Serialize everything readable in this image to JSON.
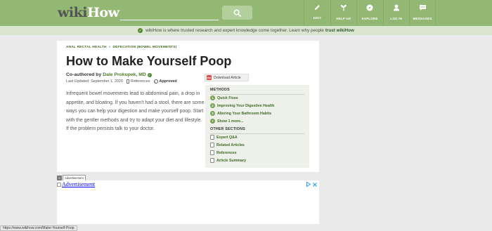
{
  "header": {
    "logo_prefix": "wiki",
    "logo_suffix": "How",
    "search_placeholder": "",
    "nav": [
      {
        "label": "EDIT",
        "icon": "pencil-icon"
      },
      {
        "label": "HELP US",
        "icon": "sprout-icon"
      },
      {
        "label": "EXPLORE",
        "icon": "compass-icon"
      },
      {
        "label": "LOG IN",
        "icon": "user-icon"
      },
      {
        "label": "MESSAGES",
        "icon": "chat-icon"
      }
    ]
  },
  "trust_bar": {
    "text": "wikiHow is where trusted research and expert knowledge come together. Learn why people",
    "bold": "trust wikiHow"
  },
  "article": {
    "breadcrumbs": [
      "ANAL RECTAL HEALTH",
      "DEFECATION (BOWEL MOVEMENTS)"
    ],
    "breadcrumb_separator": "»",
    "title": "How to Make Yourself Poop",
    "coauthor_prefix": "Co-authored by",
    "coauthor_name": "Dale Prokupek, MD",
    "last_updated": "Last Updated: September 1, 2020",
    "references_label": "References",
    "approved_label": "Approved",
    "intro": "Infrequent bowel movements lead to abdominal pain, a drop in appetite, and bloating. If you haven't had a stool, there are some ways you can help your digestion and make yourself poop. Start with the gentler methods and try to adapt your diet and lifestyle. If the problem persists talk to your doctor.",
    "download_label": "Download Article",
    "download_icon_text": "PDF"
  },
  "toc": {
    "methods_heading": "METHODS",
    "methods": [
      {
        "num": "1",
        "label": "Quick Fixes"
      },
      {
        "num": "2",
        "label": "Improving Your Digestive Health"
      },
      {
        "num": "3",
        "label": "Altering Your Bathroom Habits"
      },
      {
        "num": "+",
        "label": "Show 1 more..."
      }
    ],
    "other_heading": "OTHER SECTIONS",
    "other": [
      {
        "label": "Expert Q&A",
        "icon": "qa-icon"
      },
      {
        "label": "Related Articles",
        "icon": "related-articles-icon"
      },
      {
        "label": "References",
        "icon": "references-icon"
      },
      {
        "label": "Article Summary",
        "icon": "summary-icon"
      }
    ]
  },
  "ad": {
    "badge": "X",
    "label": "Advertisement",
    "image_alt": "Advertisement"
  },
  "status_bar": {
    "url": "https://www.wikihow.com/Make-Yourself-Poop"
  }
}
